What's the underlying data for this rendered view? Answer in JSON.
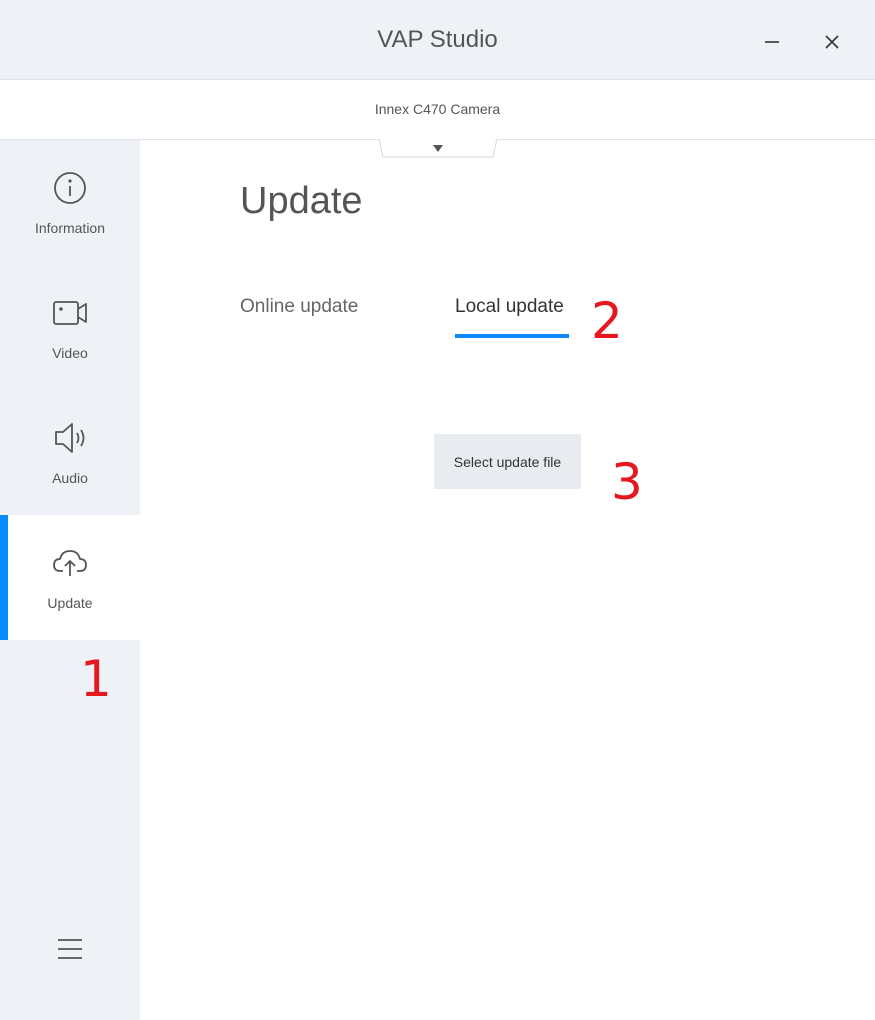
{
  "window": {
    "title": "VAP Studio",
    "minimize_icon": "minimize-icon",
    "close_icon": "close-icon"
  },
  "device": {
    "name": "Innex C470 Camera",
    "dropdown_icon": "caret-down-icon"
  },
  "sidebar": {
    "items": [
      {
        "label": "Information",
        "icon": "info-icon",
        "active": false
      },
      {
        "label": "Video",
        "icon": "video-camera-icon",
        "active": false
      },
      {
        "label": "Audio",
        "icon": "speaker-icon",
        "active": false
      },
      {
        "label": "Update",
        "icon": "cloud-upload-icon",
        "active": true
      }
    ],
    "menu_icon": "hamburger-menu-icon",
    "accent": "#0a8bfb"
  },
  "main": {
    "title": "Update",
    "tabs": [
      {
        "label": "Online update",
        "active": false
      },
      {
        "label": "Local update",
        "active": true
      }
    ],
    "select_button_label": "Select update file"
  },
  "annotations": [
    "1",
    "2",
    "3"
  ],
  "colors": {
    "accent": "#0a8bfb",
    "annotation": "#e6171e",
    "sidebar_bg": "#eef1f6"
  }
}
